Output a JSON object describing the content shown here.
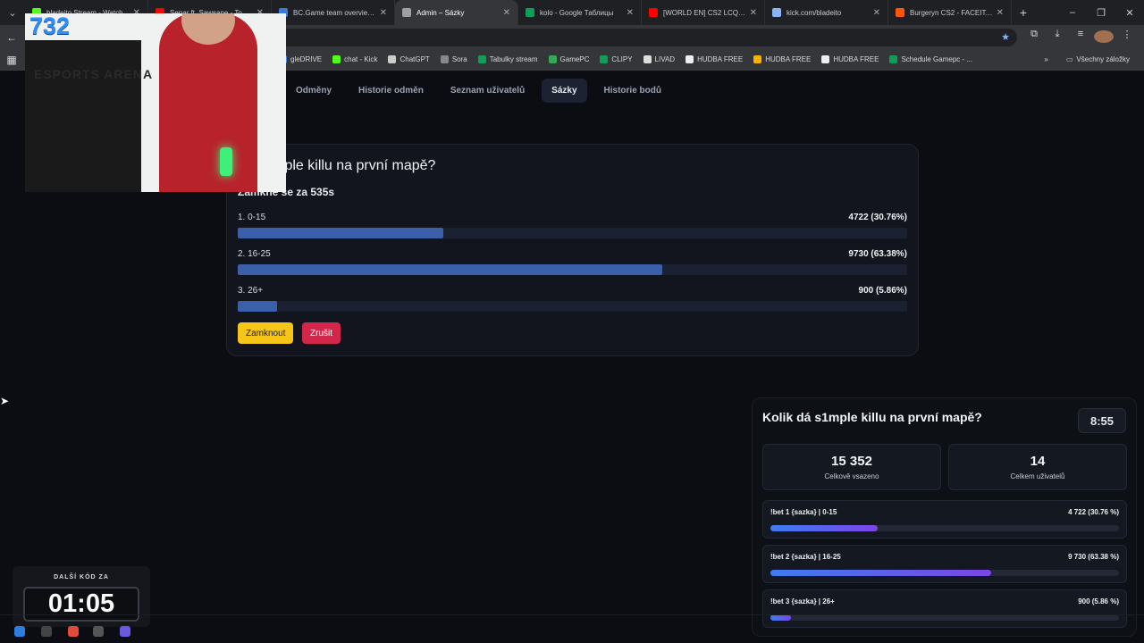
{
  "tabs": [
    {
      "title": "bladeito Stream - Watch ",
      "color": "#53fc18",
      "active": false
    },
    {
      "title": "Separ ft. Sawsane - To",
      "color": "#ff0000",
      "active": false
    },
    {
      "title": "BC.Game team overview | ",
      "color": "#3a7bd5",
      "active": false
    },
    {
      "title": "Admin – Sázky",
      "color": "#9aa0a6",
      "active": true
    },
    {
      "title": "kolo - Google Таблицы",
      "color": "#0f9d58",
      "active": false
    },
    {
      "title": "[WORLD EN] CS2 LCQ - Y",
      "color": "#ff0000",
      "active": false
    },
    {
      "title": "kick.com/bladeito",
      "color": "#8ab4f8",
      "active": false
    },
    {
      "title": "Burgeryn CS2 - FACEIT.co",
      "color": "#ff5500",
      "active": false
    }
  ],
  "bookmarks": [
    {
      "label": "gleDRIVE",
      "color": "#4285f4"
    },
    {
      "label": "chat - Kick",
      "color": "#53fc18"
    },
    {
      "label": "ChatGPT",
      "color": "#cccccc"
    },
    {
      "label": "Sora",
      "color": "#888888"
    },
    {
      "label": "Tabulky stream",
      "color": "#0f9d58"
    },
    {
      "label": "GamePC",
      "color": "#34a853"
    },
    {
      "label": "CLIPY",
      "color": "#0f9d58"
    },
    {
      "label": "LIVAD",
      "color": "#dddddd"
    },
    {
      "label": "HUDBA FREE",
      "color": "#eeeeee"
    },
    {
      "label": "HUDBA FREE",
      "color": "#f4b400"
    },
    {
      "label": "HUDBA FREE",
      "color": "#eeeeee"
    },
    {
      "label": "Schedule Gamepc - ...",
      "color": "#0f9d58"
    }
  ],
  "bookmarks_all": "Všechny záložky",
  "nav": {
    "rewards": "Odměny",
    "reward_history": "Historie odměn",
    "users": "Seznam uživatelů",
    "bets": "Sázky",
    "points_history": "Historie bodů"
  },
  "bet": {
    "question": "dá s1mple killu na první mapě?",
    "lock_text": "Zamkne se za 535s",
    "options": [
      {
        "label": "1. 0-15",
        "value": "4722 (30.76%)",
        "percent": 30.76
      },
      {
        "label": "2. 16-25",
        "value": "9730 (63.38%)",
        "percent": 63.38
      },
      {
        "label": "3. 26+",
        "value": "900 (5.86%)",
        "percent": 5.86
      }
    ],
    "lock_button": "Zamknout",
    "cancel_button": "Zrušit"
  },
  "cam": {
    "counter": "732",
    "logo": "ESPORTS ARENA"
  },
  "widget": {
    "question": "Kolik dá s1mple killu na první mapě?",
    "timer": "8:55",
    "total_bet": "15 352",
    "total_bet_label": "Celkově vsazeno",
    "total_users": "14",
    "total_users_label": "Celkem uživatelů",
    "options": [
      {
        "label": "!bet 1 {sazka} | 0-15",
        "value": "4 722 (30.76 %)",
        "percent": 30.76
      },
      {
        "label": "!bet 2 {sazka} | 16-25",
        "value": "9 730 (63.38 %)",
        "percent": 63.38
      },
      {
        "label": "!bet 3 {sazka} | 26+",
        "value": "900 (5.86 %)",
        "percent": 5.86
      }
    ]
  },
  "next_code": {
    "title": "DALŠÍ KÓD ZA",
    "time": "01:05"
  }
}
